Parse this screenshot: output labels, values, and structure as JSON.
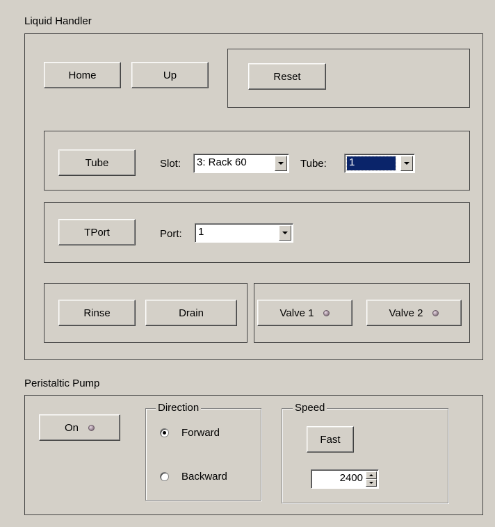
{
  "liquid_handler": {
    "title": "Liquid Handler",
    "home_label": "Home",
    "up_label": "Up",
    "reset_label": "Reset",
    "tube_label": "Tube",
    "slot_label": "Slot:",
    "slot_value": "3: Rack 60",
    "tube_field_label": "Tube:",
    "tube_value": "1",
    "tport_label": "TPort",
    "port_label": "Port:",
    "port_value": "1",
    "rinse_label": "Rinse",
    "drain_label": "Drain",
    "valve1_label": "Valve 1",
    "valve2_label": "Valve 2"
  },
  "peristaltic_pump": {
    "title": "Peristaltic Pump",
    "on_label": "On",
    "direction": {
      "title": "Direction",
      "options": [
        "Forward",
        "Backward"
      ],
      "selected": "Forward"
    },
    "speed": {
      "title": "Speed",
      "fast_label": "Fast",
      "value": "2400"
    }
  },
  "colors": {
    "background": "#d4d0c8",
    "selection": "#0a246a",
    "led": "#9a8894"
  }
}
